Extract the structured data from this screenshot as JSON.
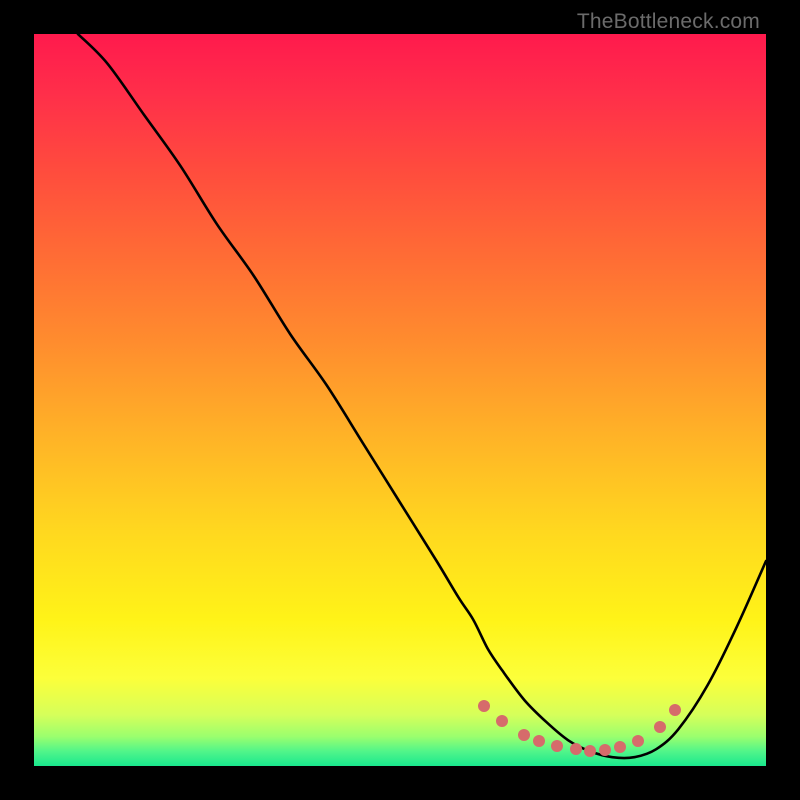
{
  "watermark": "TheBottleneck.com",
  "chart_data": {
    "type": "line",
    "title": "",
    "xlabel": "",
    "ylabel": "",
    "xlim": [
      0,
      100
    ],
    "ylim": [
      0,
      100
    ],
    "series": [
      {
        "name": "bottleneck-curve",
        "x": [
          6,
          10,
          15,
          20,
          25,
          30,
          35,
          40,
          45,
          50,
          55,
          58,
          60,
          62,
          64,
          67,
          70,
          73,
          76,
          79,
          82,
          85,
          88,
          92,
          96,
          100
        ],
        "y": [
          100,
          96,
          89,
          82,
          74,
          67,
          59,
          52,
          44,
          36,
          28,
          23,
          20,
          16,
          13,
          9,
          6,
          3.5,
          2,
          1.2,
          1.2,
          2.3,
          5,
          11,
          19,
          28
        ]
      }
    ],
    "markers": {
      "name": "valley-dots",
      "points": [
        {
          "x": 61.5,
          "y": 8.2
        },
        {
          "x": 64.0,
          "y": 6.2
        },
        {
          "x": 67.0,
          "y": 4.3
        },
        {
          "x": 69.0,
          "y": 3.4
        },
        {
          "x": 71.5,
          "y": 2.7
        },
        {
          "x": 74.0,
          "y": 2.3
        },
        {
          "x": 76.0,
          "y": 2.1
        },
        {
          "x": 78.0,
          "y": 2.2
        },
        {
          "x": 80.0,
          "y": 2.6
        },
        {
          "x": 82.5,
          "y": 3.4
        },
        {
          "x": 85.5,
          "y": 5.3
        },
        {
          "x": 87.5,
          "y": 7.6
        }
      ]
    },
    "gradient_stops": [
      {
        "pct": 0,
        "color": "#ff1a4d"
      },
      {
        "pct": 50,
        "color": "#ffc225"
      },
      {
        "pct": 88,
        "color": "#fcff3a"
      },
      {
        "pct": 100,
        "color": "#19e88d"
      }
    ]
  }
}
